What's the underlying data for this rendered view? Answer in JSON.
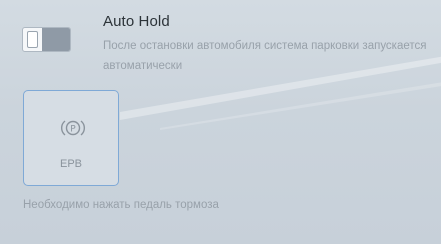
{
  "auto_hold": {
    "title": "Auto Hold",
    "description": "После остановки автомобиля система парковки запускается автоматически",
    "toggle_state": "off"
  },
  "epb": {
    "label": "EPB",
    "icon": "parking-brake-icon"
  },
  "note": "Необходимо нажать педаль тормоза",
  "colors": {
    "background": "#cbd4dc",
    "title_text": "#2c3338",
    "secondary_text": "#98a1aa",
    "epb_border": "#7fa9d6",
    "toggle_off": "#8f9aa6"
  }
}
